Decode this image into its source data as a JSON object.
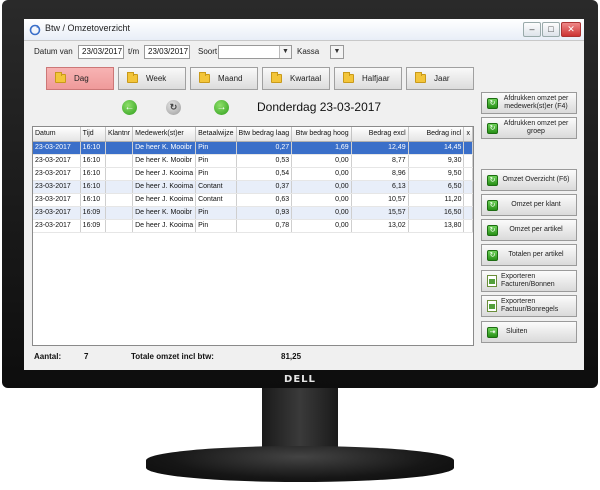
{
  "window": {
    "title": "Btw / Omzetoverzicht"
  },
  "filters": {
    "date_from_label": "Datum van",
    "date_from": "23/03/2017",
    "date_to_label": "t/m",
    "date_to": "23/03/2017",
    "type_label": "Soort",
    "type_value": "",
    "register_label": "Kassa",
    "register_value": ""
  },
  "periods": [
    {
      "label": "Dag",
      "active": true
    },
    {
      "label": "Week"
    },
    {
      "label": "Maand"
    },
    {
      "label": "Kwartaal"
    },
    {
      "label": "Halfjaar"
    },
    {
      "label": "Jaar"
    }
  ],
  "current_date_title": "Donderdag 23-03-2017",
  "table": {
    "columns": [
      "Datum",
      "Tijd",
      "Klantnr",
      "Medewerk(st)er",
      "Betaalwijze",
      "Btw bedrag laag",
      "Btw bedrag hoog",
      "Bedrag excl",
      "Bedrag incl",
      "x"
    ],
    "rows": [
      [
        "23-03-2017",
        "16:10",
        "",
        "De heer K. Mooibr",
        "Pin",
        "0,27",
        "1,69",
        "12,49",
        "14,45",
        ""
      ],
      [
        "23-03-2017",
        "16:10",
        "",
        "De heer K. Mooibr",
        "Pin",
        "0,53",
        "0,00",
        "8,77",
        "9,30",
        ""
      ],
      [
        "23-03-2017",
        "16:10",
        "",
        "De heer J. Kooima",
        "Pin",
        "0,54",
        "0,00",
        "8,96",
        "9,50",
        ""
      ],
      [
        "23-03-2017",
        "16:10",
        "",
        "De heer J. Kooima",
        "Contant",
        "0,37",
        "0,00",
        "6,13",
        "6,50",
        ""
      ],
      [
        "23-03-2017",
        "16:10",
        "",
        "De heer J. Kooima",
        "Contant",
        "0,63",
        "0,00",
        "10,57",
        "11,20",
        ""
      ],
      [
        "23-03-2017",
        "16:09",
        "",
        "De heer K. Mooibr",
        "Pin",
        "0,93",
        "0,00",
        "15,57",
        "16,50",
        ""
      ],
      [
        "23-03-2017",
        "16:09",
        "",
        "De heer J. Kooima",
        "Pin",
        "0,78",
        "0,00",
        "13,02",
        "13,80",
        ""
      ]
    ]
  },
  "footer": {
    "count_label": "Aantal:",
    "count_value": "7",
    "total_label": "Totale omzet incl btw:",
    "total_value": "81,25"
  },
  "side_buttons": [
    "Afdrukken omzet per medewerk(st)er (F4)",
    "Afdrukken omzet per groep",
    "Omzet Overzicht (F6)",
    "Omzet per klant",
    "Omzet per artikel",
    "Totalen per artikel",
    "Exporteren Facturen/Bonnen",
    "Exporteren Factuur/Bonregels",
    "Sluiten"
  ],
  "brand": "DELL"
}
